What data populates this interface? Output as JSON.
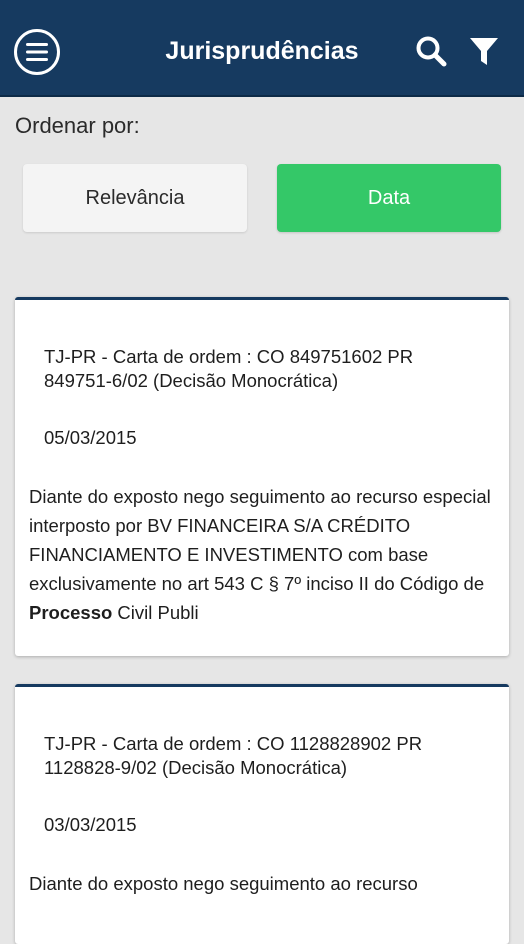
{
  "appbar": {
    "title": "Jurisprudências",
    "menu_icon": "hamburger-circle-icon",
    "search_icon": "search-icon",
    "filter_icon": "filter-funnel-icon",
    "background": "#163a60"
  },
  "sort": {
    "label": "Ordenar por:",
    "options": [
      {
        "label": "Relevância",
        "selected": false
      },
      {
        "label": "Data",
        "selected": true
      }
    ],
    "selected_color": "#34c868"
  },
  "results": [
    {
      "title": "TJ-PR - Carta de ordem : CO 849751602 PR 849751-6/02 (Decisão Monocrática)",
      "date": "05/03/2015",
      "excerpt_before": "Diante do exposto nego seguimento ao recurso especial interposto por BV FINANCEIRA S/A CRÉDITO FINANCIAMENTO E INVESTIMENTO com base exclusivamente no art 543 C § 7º inciso II do Código de ",
      "excerpt_highlight": "Processo",
      "excerpt_after": " Civil Publi"
    },
    {
      "title": "TJ-PR - Carta de ordem : CO 1128828902 PR 1128828-9/02 (Decisão Monocrática)",
      "date": "03/03/2015",
      "excerpt_before": "Diante do exposto nego seguimento ao recurso",
      "excerpt_highlight": "",
      "excerpt_after": ""
    }
  ]
}
